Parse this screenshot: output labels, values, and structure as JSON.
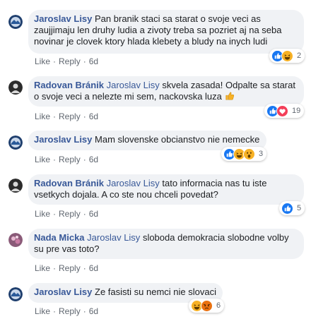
{
  "colors": {
    "like_blue": "#1877f2",
    "love_red": "#f33e58",
    "haha_yellow": "#f7b125",
    "angry_orange": "#e9710f",
    "bubble_bg": "#f0f2f5",
    "author_blue": "#385898"
  },
  "comments": [
    {
      "author": "Jaroslav Lisy",
      "mention": "",
      "text": "Pan branik staci sa starat o svoje veci as zaujjimaju len druhy ludia a zivoty treba sa pozriet aj na seba novinar je clovek ktory hlada klebety a bludy na inych ludi",
      "actions": {
        "like": "Like",
        "reply": "Reply",
        "time": "6d"
      },
      "reactions": {
        "icons": [
          "like-icon",
          "haha-icon"
        ],
        "count": "2"
      }
    },
    {
      "author": "Radovan Bránik",
      "mention": "Jaroslav Lisy",
      "text": "skvela zasada! Odpalte sa starat o svoje veci a nelezte mi sem, nackovska luza",
      "emoji": "thumbs-up-emoji",
      "actions": {
        "like": "Like",
        "reply": "Reply",
        "time": "6d"
      },
      "reactions": {
        "icons": [
          "like-icon",
          "love-icon"
        ],
        "count": "19"
      }
    },
    {
      "author": "Jaroslav Lisy",
      "mention": "",
      "text": "Mam slovenske obcianstvo nie nemecke",
      "actions": {
        "like": "Like",
        "reply": "Reply",
        "time": "6d"
      },
      "reactions": {
        "icons": [
          "like-icon",
          "haha-icon",
          "wow-icon"
        ],
        "count": "3"
      }
    },
    {
      "author": "Radovan Bránik",
      "mention": "Jaroslav Lisy",
      "text": "tato informacia nas tu iste vsetkych dojala. A co ste nou chceli povedat?",
      "actions": {
        "like": "Like",
        "reply": "Reply",
        "time": "6d"
      },
      "reactions": {
        "icons": [
          "like-icon"
        ],
        "count": "5"
      }
    },
    {
      "author": "Nada Micka",
      "mention": "Jaroslav Lisy",
      "text": "sloboda demokracia slobodne volby su pre vas toto?",
      "actions": {
        "like": "Like",
        "reply": "Reply",
        "time": "6d"
      },
      "reactions": null
    },
    {
      "author": "Jaroslav Lisy",
      "mention": "",
      "text": "Ze fasisti su nemci nie slovaci",
      "actions": {
        "like": "Like",
        "reply": "Reply",
        "time": "6d"
      },
      "reactions": {
        "icons": [
          "haha-icon",
          "angry-icon"
        ],
        "count": "6"
      }
    }
  ]
}
